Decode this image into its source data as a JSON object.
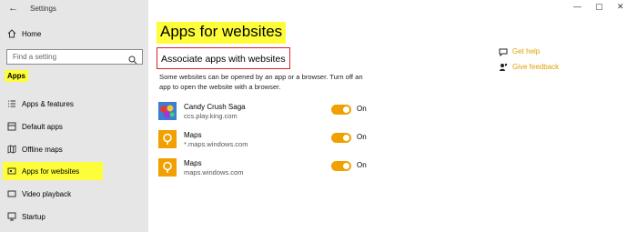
{
  "window": {
    "title": "Settings",
    "controls": {
      "minimize": "—",
      "maximize": "▢",
      "close": "✕"
    }
  },
  "sidebar": {
    "home_label": "Home",
    "search_placeholder": "Find a setting",
    "section_label": "Apps",
    "items": [
      {
        "label": "Apps & features",
        "icon": "list-icon"
      },
      {
        "label": "Default apps",
        "icon": "default-apps-icon"
      },
      {
        "label": "Offline maps",
        "icon": "map-icon"
      },
      {
        "label": "Apps for websites",
        "icon": "web-app-icon",
        "selected": true
      },
      {
        "label": "Video playback",
        "icon": "video-icon"
      },
      {
        "label": "Startup",
        "icon": "startup-icon"
      }
    ]
  },
  "main": {
    "title": "Apps for websites",
    "subtitle": "Associate apps with websites",
    "description": "Some websites can be opened by an app or a browser.  Turn off an app to open the website with a browser.",
    "apps": [
      {
        "name": "Candy Crush Saga",
        "url": "ccs.play.king.com",
        "state": "On",
        "icon": "candy-crush-icon"
      },
      {
        "name": "Maps",
        "url": "*.maps.windows.com",
        "state": "On",
        "icon": "maps-icon"
      },
      {
        "name": "Maps",
        "url": "maps.windows.com",
        "state": "On",
        "icon": "maps-icon"
      }
    ],
    "links": [
      {
        "label": "Get help",
        "icon": "help-chat-icon"
      },
      {
        "label": "Give feedback",
        "icon": "feedback-icon"
      }
    ]
  },
  "colors": {
    "accent": "#f0a000",
    "highlight": "#fdfd3a",
    "red_box": "#d8232a",
    "link": "#e0a200"
  }
}
